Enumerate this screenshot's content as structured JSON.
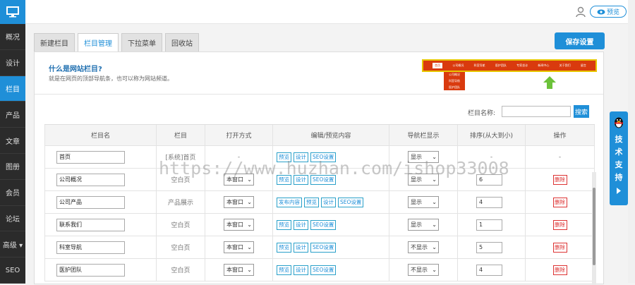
{
  "sidebar": {
    "items": [
      {
        "label": "概况"
      },
      {
        "label": "设计"
      },
      {
        "label": "栏目",
        "active": true
      },
      {
        "label": "产品"
      },
      {
        "label": "文章"
      },
      {
        "label": "图册"
      },
      {
        "label": "会员"
      },
      {
        "label": "论坛"
      },
      {
        "label": "高级 ▾"
      },
      {
        "label": "SEO"
      }
    ]
  },
  "topbar": {
    "preview_label": "预览"
  },
  "tabs": [
    {
      "label": "新建栏目"
    },
    {
      "label": "栏目管理",
      "active": true
    },
    {
      "label": "下拉菜单"
    },
    {
      "label": "回收站"
    }
  ],
  "save_label": "保存设置",
  "info": {
    "title": "什么是网站栏目?",
    "desc": "就是在网页的顶部导航条，也可以称为网站频道。",
    "demo_nav": [
      "首页",
      "公司概况",
      "科室导航",
      "医护团队",
      "专家坐诊",
      "新闻中心",
      "关于我们",
      "留言"
    ],
    "demo_drop": [
      "公司概况",
      "科室导航",
      "医护团队"
    ]
  },
  "search": {
    "label": "栏目名称:",
    "button": "搜索"
  },
  "table": {
    "headers": [
      "栏目名",
      "栏目",
      "打开方式",
      "编辑/预览内容",
      "导航栏显示",
      "排序(从大到小)",
      "操作"
    ],
    "rows": [
      {
        "name": "首页",
        "type": "[系统]首页",
        "open": "-",
        "edit": [
          "预览",
          "设计",
          "SEO设置"
        ],
        "nav": "显示",
        "order": "-",
        "action": "-"
      },
      {
        "name": "公司概况",
        "type": "空白页",
        "open": "本窗口",
        "edit": [
          "预览",
          "设计",
          "SEO设置"
        ],
        "nav": "显示",
        "order": "6",
        "action": "删除"
      },
      {
        "name": "公司产品",
        "type": "产品展示",
        "open": "本窗口",
        "edit": [
          "发布内容",
          "预览",
          "设计",
          "SEO设置"
        ],
        "nav": "显示",
        "order": "4",
        "action": "删除"
      },
      {
        "name": "联系我们",
        "type": "空白页",
        "open": "本窗口",
        "edit": [
          "预览",
          "设计",
          "SEO设置"
        ],
        "nav": "显示",
        "order": "1",
        "action": "删除"
      },
      {
        "name": "科室导航",
        "type": "空白页",
        "open": "本窗口",
        "edit": [
          "预览",
          "设计",
          "SEO设置"
        ],
        "nav": "不显示",
        "order": "5",
        "action": "删除"
      },
      {
        "name": "医护团队",
        "type": "空白页",
        "open": "本窗口",
        "edit": [
          "预览",
          "设计",
          "SEO设置"
        ],
        "nav": "不显示",
        "order": "4",
        "action": "删除"
      }
    ]
  },
  "watermark": "https://www.huzhan.com/ishop33008",
  "support": {
    "chars": [
      "技",
      "术",
      "支",
      "持"
    ]
  },
  "colors": {
    "accent": "#1f8fd8",
    "sidebar": "#2b2b2b",
    "danger": "#dd3333",
    "demo_nav": "#d93a0e"
  }
}
